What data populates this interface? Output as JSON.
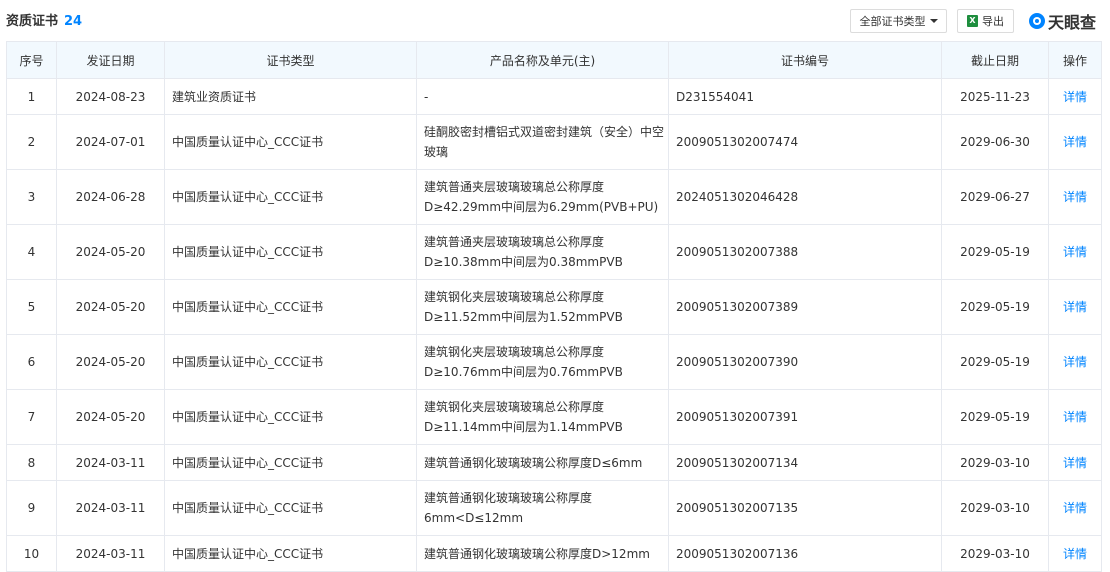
{
  "header": {
    "title": "资质证书",
    "count": "24",
    "filter_label": "全部证书类型",
    "export_label": "导出",
    "export_icon": "excel-icon",
    "logo_text": "天眼查"
  },
  "table": {
    "columns": [
      "序号",
      "发证日期",
      "证书类型",
      "产品名称及单元(主)",
      "证书编号",
      "截止日期",
      "操作"
    ],
    "rows": [
      {
        "idx": "1",
        "issue": "2024-08-23",
        "type": "建筑业资质证书",
        "product": "-",
        "number": "D231554041",
        "expire": "2025-11-23",
        "action": "详情"
      },
      {
        "idx": "2",
        "issue": "2024-07-01",
        "type": "中国质量认证中心_CCC证书",
        "product": "硅酮胶密封槽铝式双道密封建筑（安全）中空玻璃",
        "number": "2009051302007474",
        "expire": "2029-06-30",
        "action": "详情"
      },
      {
        "idx": "3",
        "issue": "2024-06-28",
        "type": "中国质量认证中心_CCC证书",
        "product": "建筑普通夹层玻璃玻璃总公称厚度D≥42.29mm中间层为6.29mm(PVB+PU)",
        "number": "2024051302046428",
        "expire": "2029-06-27",
        "action": "详情"
      },
      {
        "idx": "4",
        "issue": "2024-05-20",
        "type": "中国质量认证中心_CCC证书",
        "product": "建筑普通夹层玻璃玻璃总公称厚度D≥10.38mm中间层为0.38mmPVB",
        "number": "2009051302007388",
        "expire": "2029-05-19",
        "action": "详情"
      },
      {
        "idx": "5",
        "issue": "2024-05-20",
        "type": "中国质量认证中心_CCC证书",
        "product": "建筑钢化夹层玻璃玻璃总公称厚度D≥11.52mm中间层为1.52mmPVB",
        "number": "2009051302007389",
        "expire": "2029-05-19",
        "action": "详情"
      },
      {
        "idx": "6",
        "issue": "2024-05-20",
        "type": "中国质量认证中心_CCC证书",
        "product": "建筑钢化夹层玻璃玻璃总公称厚度D≥10.76mm中间层为0.76mmPVB",
        "number": "2009051302007390",
        "expire": "2029-05-19",
        "action": "详情"
      },
      {
        "idx": "7",
        "issue": "2024-05-20",
        "type": "中国质量认证中心_CCC证书",
        "product": "建筑钢化夹层玻璃玻璃总公称厚度D≥11.14mm中间层为1.14mmPVB",
        "number": "2009051302007391",
        "expire": "2029-05-19",
        "action": "详情"
      },
      {
        "idx": "8",
        "issue": "2024-03-11",
        "type": "中国质量认证中心_CCC证书",
        "product": "建筑普通钢化玻璃玻璃公称厚度D≤6mm",
        "number": "2009051302007134",
        "expire": "2029-03-10",
        "action": "详情"
      },
      {
        "idx": "9",
        "issue": "2024-03-11",
        "type": "中国质量认证中心_CCC证书",
        "product": "建筑普通钢化玻璃玻璃公称厚度6mm<D≤12mm",
        "number": "2009051302007135",
        "expire": "2029-03-10",
        "action": "详情"
      },
      {
        "idx": "10",
        "issue": "2024-03-11",
        "type": "中国质量认证中心_CCC证书",
        "product": "建筑普通钢化玻璃玻璃公称厚度D>12mm",
        "number": "2009051302007136",
        "expire": "2029-03-10",
        "action": "详情"
      }
    ]
  },
  "colors": {
    "accent": "#0084ff",
    "header_bg": "#f2f9fe",
    "border": "#e6e9ef"
  }
}
